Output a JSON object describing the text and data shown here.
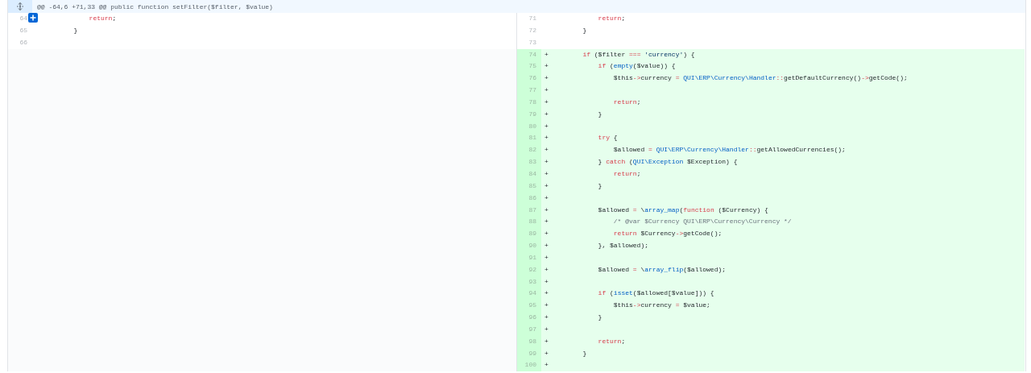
{
  "hunk_header": {
    "text": "@@ -64,6 +71,33 @@ public function setFilter($filter, $value)"
  },
  "rows": [
    {
      "left": {
        "number": "64",
        "comment_button": true,
        "tokens": [
          {
            "kind": "keyword",
            "text": "            return"
          },
          {
            "kind": "plain",
            "text": ";"
          }
        ]
      },
      "right": {
        "number": "71",
        "added": false,
        "tokens": [
          {
            "kind": "keyword",
            "text": "            return"
          },
          {
            "kind": "plain",
            "text": ";"
          }
        ]
      }
    },
    {
      "left": {
        "number": "65",
        "comment_button": false,
        "tokens": [
          {
            "kind": "plain",
            "text": "        }"
          }
        ]
      },
      "right": {
        "number": "72",
        "added": false,
        "tokens": [
          {
            "kind": "plain",
            "text": "        }"
          }
        ]
      }
    },
    {
      "left": {
        "number": "66",
        "comment_button": false
      },
      "right": {
        "number": "73",
        "added": false
      }
    },
    {
      "right": {
        "number": "74",
        "added": true,
        "marker": "+",
        "tokens": [
          {
            "kind": "keyword",
            "text": "        if"
          },
          {
            "kind": "plain",
            "text": " ($filter "
          },
          {
            "kind": "operator",
            "text": "==="
          },
          {
            "kind": "string",
            "text": " 'currency'"
          },
          {
            "kind": "plain",
            "text": ") {"
          }
        ]
      }
    },
    {
      "right": {
        "number": "75",
        "added": true,
        "marker": "+",
        "tokens": [
          {
            "kind": "keyword",
            "text": "            if"
          },
          {
            "kind": "plain",
            "text": " ("
          },
          {
            "kind": "entity",
            "text": "empty"
          },
          {
            "kind": "plain",
            "text": "($value)) {"
          }
        ]
      }
    },
    {
      "right": {
        "number": "76",
        "added": true,
        "marker": "+",
        "tokens": [
          {
            "kind": "plain",
            "text": "                $this"
          },
          {
            "kind": "operator",
            "text": "->"
          },
          {
            "kind": "plain",
            "text": "currency "
          },
          {
            "kind": "operator",
            "text": "="
          },
          {
            "kind": "entity",
            "text": " QUI\\ERP\\Currency\\Handler"
          },
          {
            "kind": "operator",
            "text": "::"
          },
          {
            "kind": "plain",
            "text": "getDefaultCurrency()"
          },
          {
            "kind": "operator",
            "text": "->"
          },
          {
            "kind": "plain",
            "text": "getCode();"
          }
        ]
      }
    },
    {
      "right": {
        "number": "77",
        "added": true,
        "marker": "+"
      }
    },
    {
      "right": {
        "number": "78",
        "added": true,
        "marker": "+",
        "tokens": [
          {
            "kind": "keyword",
            "text": "                return"
          },
          {
            "kind": "plain",
            "text": ";"
          }
        ]
      }
    },
    {
      "right": {
        "number": "79",
        "added": true,
        "marker": "+",
        "tokens": [
          {
            "kind": "plain",
            "text": "            }"
          }
        ]
      }
    },
    {
      "right": {
        "number": "80",
        "added": true,
        "marker": "+"
      }
    },
    {
      "right": {
        "number": "81",
        "added": true,
        "marker": "+",
        "tokens": [
          {
            "kind": "keyword",
            "text": "            try"
          },
          {
            "kind": "plain",
            "text": " {"
          }
        ]
      }
    },
    {
      "right": {
        "number": "82",
        "added": true,
        "marker": "+",
        "tokens": [
          {
            "kind": "plain",
            "text": "                $allowed "
          },
          {
            "kind": "operator",
            "text": "="
          },
          {
            "kind": "entity",
            "text": " QUI\\ERP\\Currency\\Handler"
          },
          {
            "kind": "operator",
            "text": "::"
          },
          {
            "kind": "plain",
            "text": "getAllowedCurrencies();"
          }
        ]
      }
    },
    {
      "right": {
        "number": "83",
        "added": true,
        "marker": "+",
        "tokens": [
          {
            "kind": "plain",
            "text": "            } "
          },
          {
            "kind": "keyword",
            "text": "catch"
          },
          {
            "kind": "plain",
            "text": " ("
          },
          {
            "kind": "entity",
            "text": "QUI\\Exception"
          },
          {
            "kind": "plain",
            "text": " $Exception) {"
          }
        ]
      }
    },
    {
      "right": {
        "number": "84",
        "added": true,
        "marker": "+",
        "tokens": [
          {
            "kind": "keyword",
            "text": "                return"
          },
          {
            "kind": "plain",
            "text": ";"
          }
        ]
      }
    },
    {
      "right": {
        "number": "85",
        "added": true,
        "marker": "+",
        "tokens": [
          {
            "kind": "plain",
            "text": "            }"
          }
        ]
      }
    },
    {
      "right": {
        "number": "86",
        "added": true,
        "marker": "+"
      }
    },
    {
      "right": {
        "number": "87",
        "added": true,
        "marker": "+",
        "tokens": [
          {
            "kind": "plain",
            "text": "            $allowed "
          },
          {
            "kind": "operator",
            "text": "="
          },
          {
            "kind": "plain",
            "text": " \\"
          },
          {
            "kind": "entity",
            "text": "array_map"
          },
          {
            "kind": "plain",
            "text": "("
          },
          {
            "kind": "keyword",
            "text": "function"
          },
          {
            "kind": "plain",
            "text": " ($Currency) {"
          }
        ]
      }
    },
    {
      "right": {
        "number": "88",
        "added": true,
        "marker": "+",
        "tokens": [
          {
            "kind": "comment",
            "text": "                /* @var $Currency QUI\\ERP\\Currency\\Currency */"
          }
        ]
      }
    },
    {
      "right": {
        "number": "89",
        "added": true,
        "marker": "+",
        "tokens": [
          {
            "kind": "keyword",
            "text": "                return"
          },
          {
            "kind": "plain",
            "text": " $Currency"
          },
          {
            "kind": "operator",
            "text": "->"
          },
          {
            "kind": "plain",
            "text": "getCode();"
          }
        ]
      }
    },
    {
      "right": {
        "number": "90",
        "added": true,
        "marker": "+",
        "tokens": [
          {
            "kind": "plain",
            "text": "            }, $allowed);"
          }
        ]
      }
    },
    {
      "right": {
        "number": "91",
        "added": true,
        "marker": "+"
      }
    },
    {
      "right": {
        "number": "92",
        "added": true,
        "marker": "+",
        "tokens": [
          {
            "kind": "plain",
            "text": "            $allowed "
          },
          {
            "kind": "operator",
            "text": "="
          },
          {
            "kind": "plain",
            "text": " \\"
          },
          {
            "kind": "entity",
            "text": "array_flip"
          },
          {
            "kind": "plain",
            "text": "($allowed);"
          }
        ]
      }
    },
    {
      "right": {
        "number": "93",
        "added": true,
        "marker": "+"
      }
    },
    {
      "right": {
        "number": "94",
        "added": true,
        "marker": "+",
        "tokens": [
          {
            "kind": "keyword",
            "text": "            if"
          },
          {
            "kind": "plain",
            "text": " ("
          },
          {
            "kind": "entity",
            "text": "isset"
          },
          {
            "kind": "plain",
            "text": "($allowed[$value])) {"
          }
        ]
      }
    },
    {
      "right": {
        "number": "95",
        "added": true,
        "marker": "+",
        "tokens": [
          {
            "kind": "plain",
            "text": "                $this"
          },
          {
            "kind": "operator",
            "text": "->"
          },
          {
            "kind": "plain",
            "text": "currency "
          },
          {
            "kind": "operator",
            "text": "="
          },
          {
            "kind": "plain",
            "text": " $value;"
          }
        ]
      }
    },
    {
      "right": {
        "number": "96",
        "added": true,
        "marker": "+",
        "tokens": [
          {
            "kind": "plain",
            "text": "            }"
          }
        ]
      }
    },
    {
      "right": {
        "number": "97",
        "added": true,
        "marker": "+"
      }
    },
    {
      "right": {
        "number": "98",
        "added": true,
        "marker": "+",
        "tokens": [
          {
            "kind": "keyword",
            "text": "            return"
          },
          {
            "kind": "plain",
            "text": ";"
          }
        ]
      }
    },
    {
      "right": {
        "number": "99",
        "added": true,
        "marker": "+",
        "tokens": [
          {
            "kind": "plain",
            "text": "        }"
          }
        ]
      }
    },
    {
      "right": {
        "number": "100",
        "added": true,
        "marker": "+"
      }
    }
  ]
}
